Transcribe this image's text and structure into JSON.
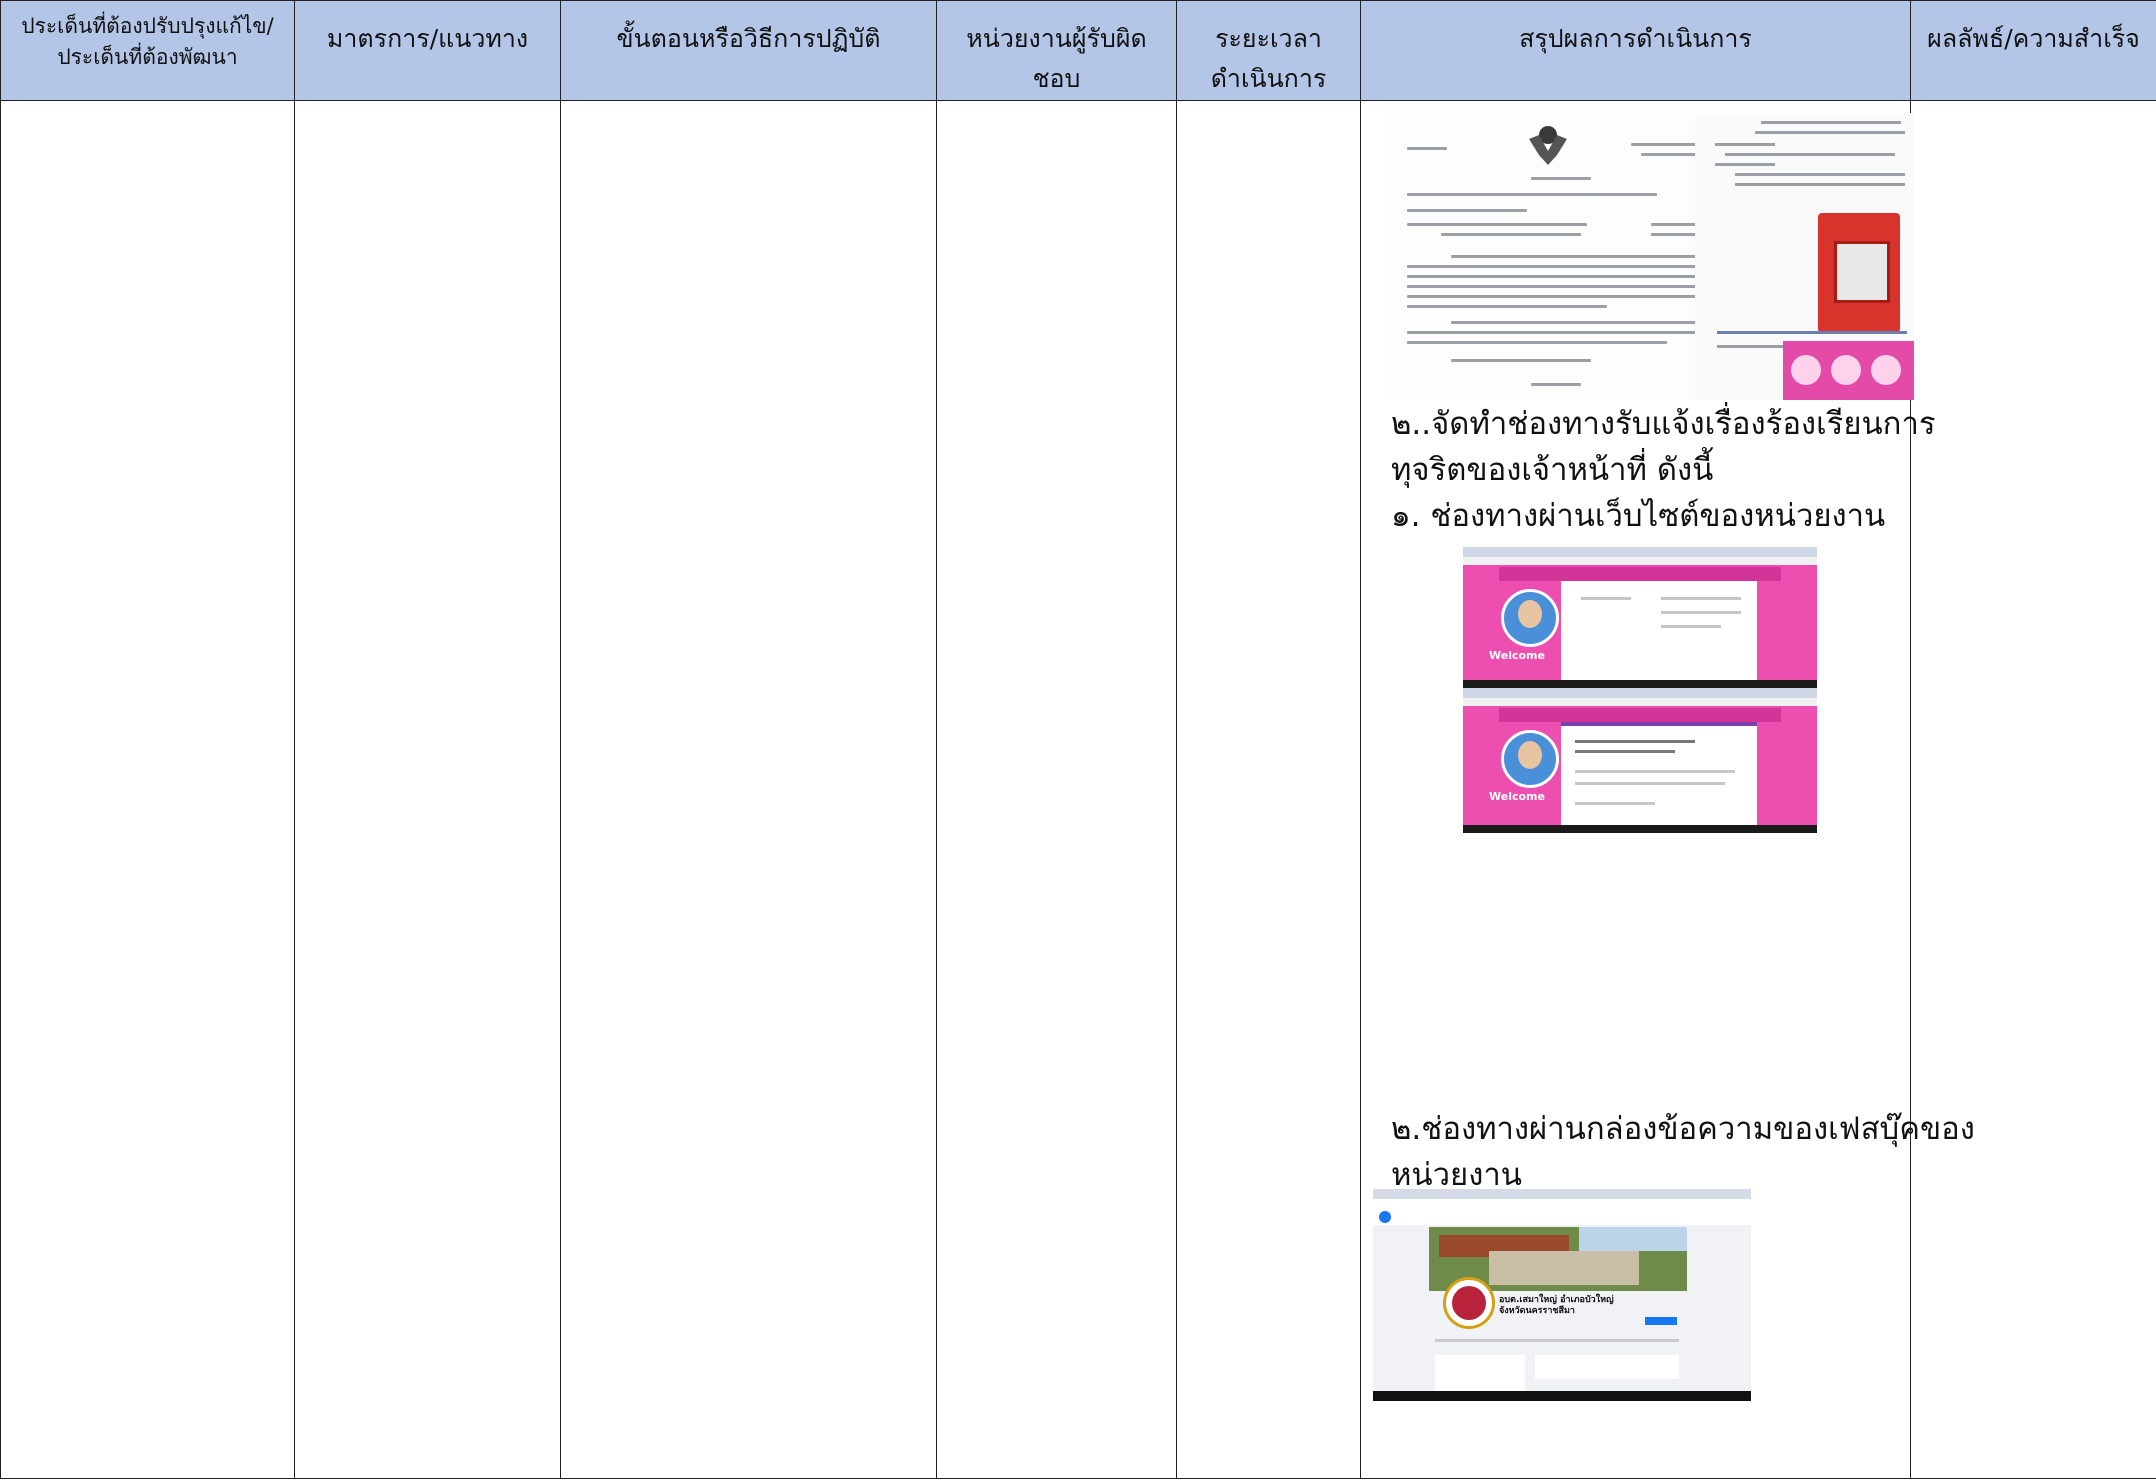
{
  "headers": {
    "col1": "ประเด็นที่ต้องปรับปรุงแก้ไข/ประเด็นที่ต้องพัฒนา",
    "col2": "มาตรการ/แนวทาง",
    "col3": "ขั้นตอนหรือวิธีการปฏิบัติ",
    "col4": "หน่วยงานผู้รับผิดชอบ",
    "col5": "ระยะเวลาดำเนินการ",
    "col6": "สรุปผลการดำเนินการ",
    "col7": "ผลลัพธ์/ความสำเร็จ"
  },
  "summary": {
    "channel_heading_line1": "๒..จัดทำช่องทางรับแจ้งเรื่องร้องเรียนการ",
    "channel_heading_line2": "ทุจริตของเจ้าหน้าที่ ดังนี้",
    "channel_1": "๑. ช่องทางผ่านเว็บไซต์ของหน่วยงาน",
    "channel_2_line1": "๒.ช่องทางผ่านกล่องข้อความของเฟสบุ๊คของ",
    "channel_2_line2": "หน่วยงาน"
  },
  "images": {
    "facebook_page_name_line1": "อบต.เสมาใหญ่ อำเภอบัวใหญ่",
    "facebook_page_name_line2": "จังหวัดนครราชสีมา",
    "website_logo_text": "Welcome"
  }
}
